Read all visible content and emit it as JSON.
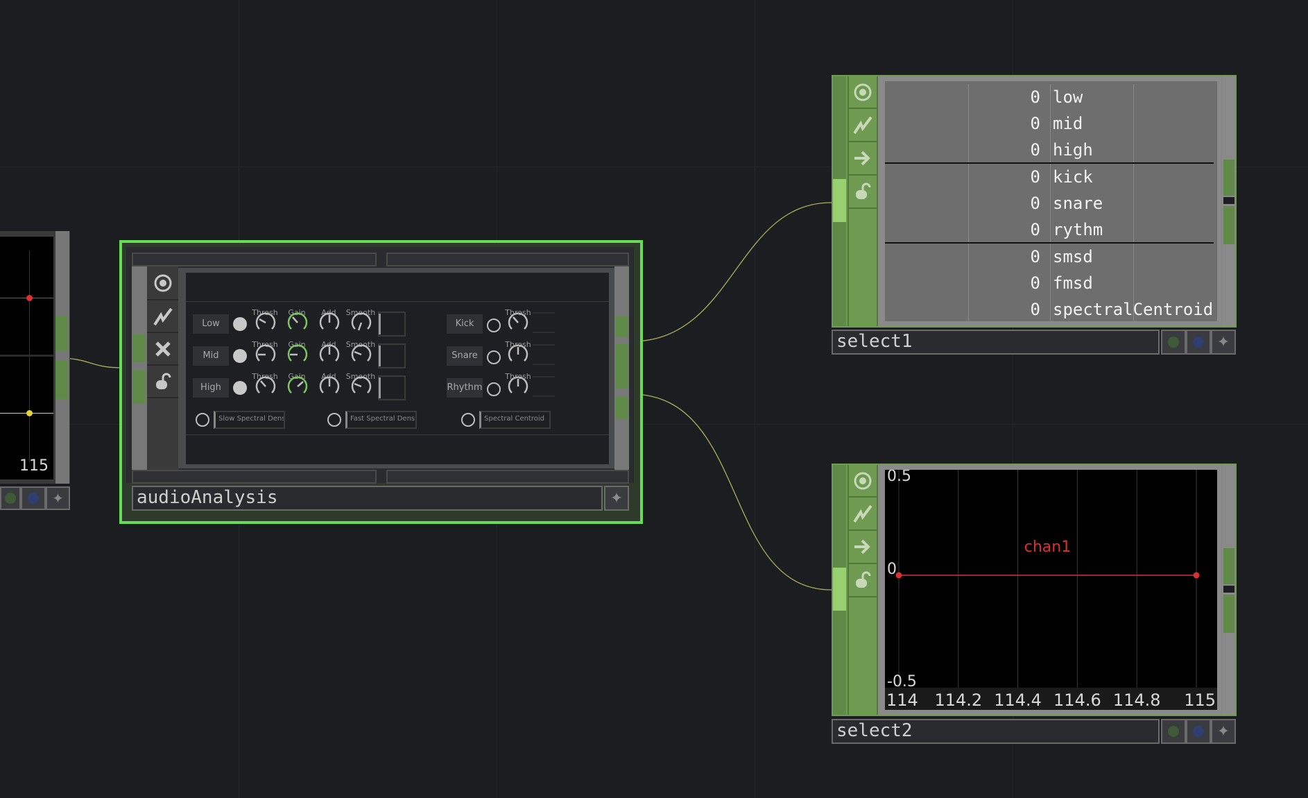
{
  "canvas": {
    "background": "#1c1d21",
    "wire_color": "#a9b15a"
  },
  "left_node": {
    "tick_label": "115",
    "marker_colors": [
      "#e03030",
      "#e6d23a"
    ]
  },
  "audio_node": {
    "name": "audioAnalysis",
    "selected_border_color": "#66dd55",
    "side_icons": [
      "viewer-icon",
      "graph-icon",
      "close-icon",
      "lock-icon"
    ],
    "bands": [
      {
        "label": "Low",
        "knobs": [
          "Thresh",
          "Gain",
          "Add",
          "Smooth"
        ]
      },
      {
        "label": "Mid",
        "knobs": [
          "Thresh",
          "Gain",
          "Add",
          "Smooth"
        ]
      },
      {
        "label": "High",
        "knobs": [
          "Thresh",
          "Gain",
          "Add",
          "Smooth"
        ]
      }
    ],
    "beats": [
      {
        "label": "Kick",
        "knob": "Thresh"
      },
      {
        "label": "Snare",
        "knob": "Thresh"
      },
      {
        "label": "Rhythm",
        "knob": "Thresh"
      }
    ],
    "spectral": [
      {
        "label": "Slow Spectral Density"
      },
      {
        "label": "Fast Spectral Density"
      },
      {
        "label": "Spectral Centroid"
      }
    ]
  },
  "select1": {
    "name": "select1",
    "side_icons": [
      "viewer-icon",
      "graph-icon",
      "arrow-right-icon",
      "lock-icon"
    ],
    "rows": [
      {
        "value": "0",
        "name": "low"
      },
      {
        "value": "0",
        "name": "mid"
      },
      {
        "value": "0",
        "name": "high"
      },
      {
        "value": "0",
        "name": "kick"
      },
      {
        "value": "0",
        "name": "snare"
      },
      {
        "value": "0",
        "name": "rythm"
      },
      {
        "value": "0",
        "name": "smsd"
      },
      {
        "value": "0",
        "name": "fmsd"
      },
      {
        "value": "0",
        "name": "spectralCentroid"
      }
    ]
  },
  "select2": {
    "name": "select2",
    "side_icons": [
      "viewer-icon",
      "graph-icon",
      "arrow-right-icon",
      "lock-icon"
    ]
  },
  "chart_data": {
    "type": "line",
    "series": [
      {
        "name": "chan1",
        "x": [
          114,
          115
        ],
        "y": [
          0,
          0
        ],
        "color": "#d93030"
      }
    ],
    "x_ticks": [
      "114",
      "114.2",
      "114.4",
      "114.6",
      "114.8",
      "115"
    ],
    "y_ticks": [
      "0.5",
      "0",
      "-0.5"
    ],
    "xlim": [
      114,
      115
    ],
    "ylim": [
      -0.5,
      0.5
    ],
    "grid": true
  }
}
